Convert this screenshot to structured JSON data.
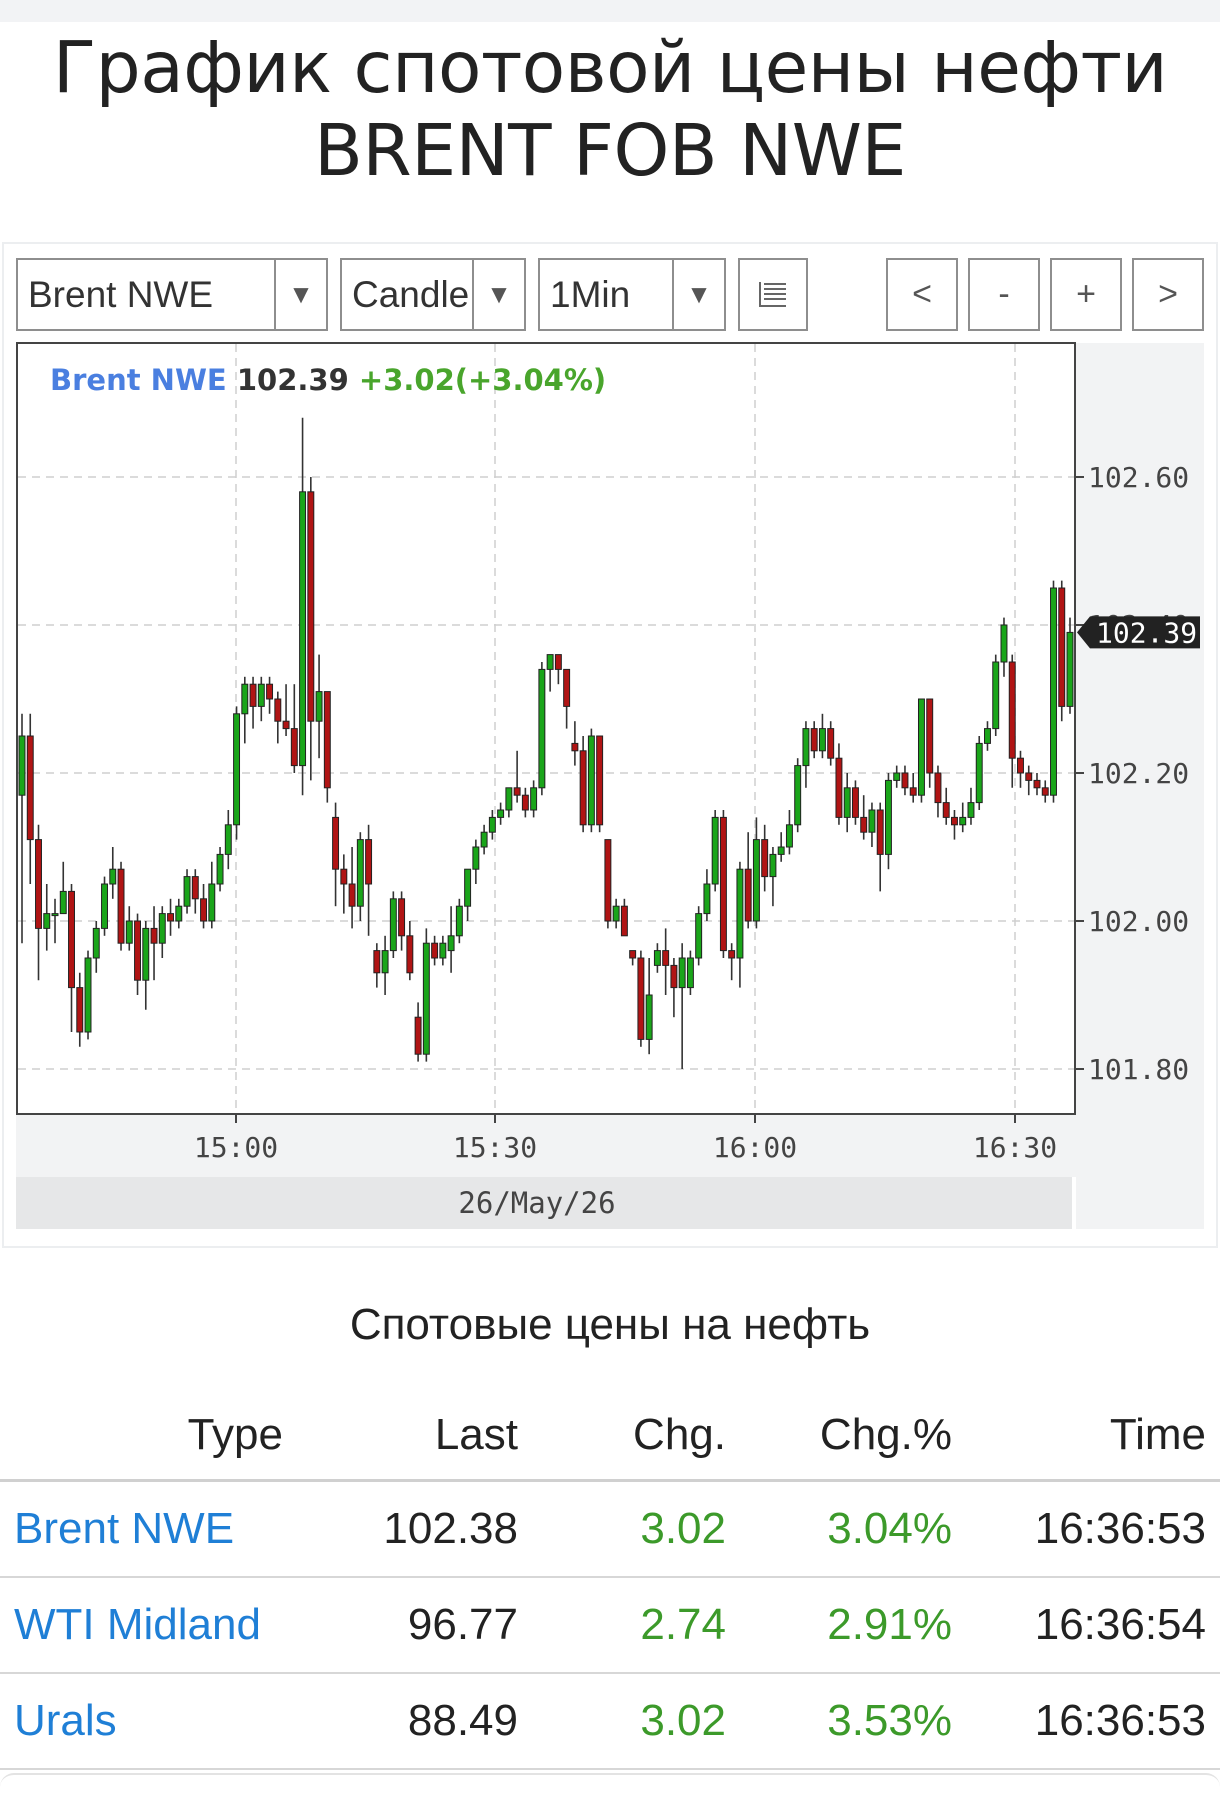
{
  "page": {
    "title": "График спотовой цены нефти BRENT FOB NWE"
  },
  "toolbar": {
    "symbol_select": "Brent NWE",
    "chart_type_select": "Candle",
    "interval_select": "1Min",
    "prev_label": "<",
    "zoom_out_label": "-",
    "zoom_in_label": "+",
    "next_label": ">"
  },
  "chart_info": {
    "symbol": "Brent NWE",
    "last": "102.39",
    "change": "+3.02(+3.04%)",
    "date_label": "26/May/26",
    "last_price_marker": "102.39"
  },
  "colors": {
    "up": "#1aa51a",
    "down": "#b01414",
    "symbol_blue": "#4a7fe0",
    "change_green": "#49a52c"
  },
  "chart_data": {
    "type": "candlestick",
    "ylim": [
      101.75,
      102.76
    ],
    "y_ticks": [
      101.8,
      102.0,
      102.2,
      102.4,
      102.6
    ],
    "y_tick_labels": [
      "101.80",
      "102.00",
      "102.20",
      "102.40",
      "102.60"
    ],
    "x_ticks": [
      "15:00",
      "15:30",
      "16:00",
      "16:30"
    ],
    "candles": [
      {
        "o": 102.17,
        "c": 102.25,
        "h": 102.28,
        "l": 101.97
      },
      {
        "o": 102.25,
        "c": 102.11,
        "h": 102.28,
        "l": 102.05
      },
      {
        "o": 102.11,
        "c": 101.99,
        "h": 102.13,
        "l": 101.92
      },
      {
        "o": 101.99,
        "c": 102.01,
        "h": 102.05,
        "l": 101.96
      },
      {
        "o": 102.01,
        "c": 102.01,
        "h": 102.03,
        "l": 101.97
      },
      {
        "o": 102.01,
        "c": 102.04,
        "h": 102.08,
        "l": 102.02
      },
      {
        "o": 102.04,
        "c": 101.91,
        "h": 102.05,
        "l": 101.85
      },
      {
        "o": 101.91,
        "c": 101.85,
        "h": 101.93,
        "l": 101.83
      },
      {
        "o": 101.85,
        "c": 101.95,
        "h": 101.96,
        "l": 101.84
      },
      {
        "o": 101.95,
        "c": 101.99,
        "h": 102.0,
        "l": 101.93
      },
      {
        "o": 101.99,
        "c": 102.05,
        "h": 102.06,
        "l": 101.98
      },
      {
        "o": 102.05,
        "c": 102.07,
        "h": 102.1,
        "l": 102.03
      },
      {
        "o": 102.07,
        "c": 101.97,
        "h": 102.08,
        "l": 101.96
      },
      {
        "o": 101.97,
        "c": 102.0,
        "h": 102.02,
        "l": 101.96
      },
      {
        "o": 102.0,
        "c": 101.92,
        "h": 102.01,
        "l": 101.9
      },
      {
        "o": 101.92,
        "c": 101.99,
        "h": 102.0,
        "l": 101.88
      },
      {
        "o": 101.99,
        "c": 101.97,
        "h": 102.02,
        "l": 101.92
      },
      {
        "o": 101.97,
        "c": 102.01,
        "h": 102.02,
        "l": 101.95
      },
      {
        "o": 102.01,
        "c": 102.0,
        "h": 102.03,
        "l": 101.98
      },
      {
        "o": 102.0,
        "c": 102.02,
        "h": 102.03,
        "l": 101.99
      },
      {
        "o": 102.02,
        "c": 102.06,
        "h": 102.07,
        "l": 102.01
      },
      {
        "o": 102.06,
        "c": 102.03,
        "h": 102.07,
        "l": 102.01
      },
      {
        "o": 102.03,
        "c": 102.0,
        "h": 102.05,
        "l": 101.99
      },
      {
        "o": 102.0,
        "c": 102.05,
        "h": 102.08,
        "l": 101.99
      },
      {
        "o": 102.05,
        "c": 102.09,
        "h": 102.1,
        "l": 102.04
      },
      {
        "o": 102.09,
        "c": 102.13,
        "h": 102.15,
        "l": 102.07
      },
      {
        "o": 102.13,
        "c": 102.28,
        "h": 102.29,
        "l": 102.11
      },
      {
        "o": 102.28,
        "c": 102.32,
        "h": 102.33,
        "l": 102.24
      },
      {
        "o": 102.32,
        "c": 102.29,
        "h": 102.33,
        "l": 102.26
      },
      {
        "o": 102.29,
        "c": 102.32,
        "h": 102.33,
        "l": 102.27
      },
      {
        "o": 102.32,
        "c": 102.3,
        "h": 102.33,
        "l": 102.28
      },
      {
        "o": 102.3,
        "c": 102.27,
        "h": 102.31,
        "l": 102.24
      },
      {
        "o": 102.27,
        "c": 102.26,
        "h": 102.32,
        "l": 102.25
      },
      {
        "o": 102.26,
        "c": 102.21,
        "h": 102.32,
        "l": 102.2
      },
      {
        "o": 102.21,
        "c": 102.58,
        "h": 102.68,
        "l": 102.17
      },
      {
        "o": 102.58,
        "c": 102.27,
        "h": 102.6,
        "l": 102.19
      },
      {
        "o": 102.27,
        "c": 102.31,
        "h": 102.36,
        "l": 102.22
      },
      {
        "o": 102.31,
        "c": 102.18,
        "h": 102.31,
        "l": 102.16
      },
      {
        "o": 102.14,
        "c": 102.07,
        "h": 102.16,
        "l": 102.02
      },
      {
        "o": 102.07,
        "c": 102.05,
        "h": 102.09,
        "l": 102.01
      },
      {
        "o": 102.05,
        "c": 102.02,
        "h": 102.1,
        "l": 101.99
      },
      {
        "o": 102.02,
        "c": 102.11,
        "h": 102.12,
        "l": 102.0
      },
      {
        "o": 102.11,
        "c": 102.05,
        "h": 102.13,
        "l": 101.98
      },
      {
        "o": 101.96,
        "c": 101.93,
        "h": 101.97,
        "l": 101.91
      },
      {
        "o": 101.93,
        "c": 101.96,
        "h": 101.98,
        "l": 101.9
      },
      {
        "o": 101.96,
        "c": 102.03,
        "h": 102.04,
        "l": 101.95
      },
      {
        "o": 102.03,
        "c": 101.98,
        "h": 102.04,
        "l": 101.96
      },
      {
        "o": 101.98,
        "c": 101.93,
        "h": 102.0,
        "l": 101.92
      },
      {
        "o": 101.87,
        "c": 101.82,
        "h": 101.89,
        "l": 101.81
      },
      {
        "o": 101.82,
        "c": 101.97,
        "h": 101.99,
        "l": 101.81
      },
      {
        "o": 101.97,
        "c": 101.95,
        "h": 101.98,
        "l": 101.94
      },
      {
        "o": 101.95,
        "c": 101.97,
        "h": 101.98,
        "l": 101.94
      },
      {
        "o": 101.96,
        "c": 101.98,
        "h": 102.02,
        "l": 101.93
      },
      {
        "o": 101.98,
        "c": 102.02,
        "h": 102.03,
        "l": 101.97
      },
      {
        "o": 102.02,
        "c": 102.07,
        "h": 102.07,
        "l": 102.0
      },
      {
        "o": 102.07,
        "c": 102.1,
        "h": 102.11,
        "l": 102.05
      },
      {
        "o": 102.1,
        "c": 102.12,
        "h": 102.13,
        "l": 102.09
      },
      {
        "o": 102.12,
        "c": 102.14,
        "h": 102.15,
        "l": 102.11
      },
      {
        "o": 102.14,
        "c": 102.15,
        "h": 102.16,
        "l": 102.13
      },
      {
        "o": 102.15,
        "c": 102.18,
        "h": 102.18,
        "l": 102.14
      },
      {
        "o": 102.18,
        "c": 102.17,
        "h": 102.23,
        "l": 102.16
      },
      {
        "o": 102.17,
        "c": 102.15,
        "h": 102.18,
        "l": 102.14
      },
      {
        "o": 102.15,
        "c": 102.18,
        "h": 102.19,
        "l": 102.14
      },
      {
        "o": 102.18,
        "c": 102.34,
        "h": 102.35,
        "l": 102.17
      },
      {
        "o": 102.34,
        "c": 102.36,
        "h": 102.36,
        "l": 102.31
      },
      {
        "o": 102.36,
        "c": 102.34,
        "h": 102.36,
        "l": 102.32
      },
      {
        "o": 102.34,
        "c": 102.29,
        "h": 102.34,
        "l": 102.26
      },
      {
        "o": 102.24,
        "c": 102.23,
        "h": 102.27,
        "l": 102.21
      },
      {
        "o": 102.23,
        "c": 102.13,
        "h": 102.25,
        "l": 102.12
      },
      {
        "o": 102.13,
        "c": 102.25,
        "h": 102.26,
        "l": 102.12
      },
      {
        "o": 102.25,
        "c": 102.13,
        "h": 102.25,
        "l": 102.12
      },
      {
        "o": 102.11,
        "c": 102.0,
        "h": 102.11,
        "l": 101.99
      },
      {
        "o": 102.0,
        "c": 102.02,
        "h": 102.03,
        "l": 101.99
      },
      {
        "o": 102.02,
        "c": 101.98,
        "h": 102.03,
        "l": 101.98
      },
      {
        "o": 101.96,
        "c": 101.95,
        "h": 101.96,
        "l": 101.94
      },
      {
        "o": 101.95,
        "c": 101.84,
        "h": 101.96,
        "l": 101.83
      },
      {
        "o": 101.84,
        "c": 101.9,
        "h": 101.95,
        "l": 101.82
      },
      {
        "o": 101.94,
        "c": 101.96,
        "h": 101.97,
        "l": 101.93
      },
      {
        "o": 101.96,
        "c": 101.94,
        "h": 101.99,
        "l": 101.9
      },
      {
        "o": 101.94,
        "c": 101.91,
        "h": 101.95,
        "l": 101.87
      },
      {
        "o": 101.91,
        "c": 101.95,
        "h": 101.97,
        "l": 101.8
      },
      {
        "o": 101.91,
        "c": 101.95,
        "h": 101.96,
        "l": 101.9
      },
      {
        "o": 101.95,
        "c": 102.01,
        "h": 102.02,
        "l": 101.94
      },
      {
        "o": 102.01,
        "c": 102.05,
        "h": 102.07,
        "l": 102.0
      },
      {
        "o": 102.05,
        "c": 102.14,
        "h": 102.15,
        "l": 102.04
      },
      {
        "o": 102.14,
        "c": 101.96,
        "h": 102.15,
        "l": 101.95
      },
      {
        "o": 101.96,
        "c": 101.95,
        "h": 101.97,
        "l": 101.92
      },
      {
        "o": 101.95,
        "c": 102.07,
        "h": 102.08,
        "l": 101.91
      },
      {
        "o": 102.07,
        "c": 102.0,
        "h": 102.12,
        "l": 101.99
      },
      {
        "o": 102.0,
        "c": 102.11,
        "h": 102.14,
        "l": 101.99
      },
      {
        "o": 102.11,
        "c": 102.06,
        "h": 102.13,
        "l": 102.04
      },
      {
        "o": 102.06,
        "c": 102.09,
        "h": 102.1,
        "l": 102.02
      },
      {
        "o": 102.09,
        "c": 102.1,
        "h": 102.12,
        "l": 102.08
      },
      {
        "o": 102.1,
        "c": 102.13,
        "h": 102.15,
        "l": 102.09
      },
      {
        "o": 102.13,
        "c": 102.21,
        "h": 102.22,
        "l": 102.12
      },
      {
        "o": 102.21,
        "c": 102.26,
        "h": 102.27,
        "l": 102.18
      },
      {
        "o": 102.26,
        "c": 102.23,
        "h": 102.27,
        "l": 102.22
      },
      {
        "o": 102.23,
        "c": 102.26,
        "h": 102.28,
        "l": 102.22
      },
      {
        "o": 102.26,
        "c": 102.22,
        "h": 102.27,
        "l": 102.21
      },
      {
        "o": 102.22,
        "c": 102.14,
        "h": 102.24,
        "l": 102.13
      },
      {
        "o": 102.14,
        "c": 102.18,
        "h": 102.2,
        "l": 102.12
      },
      {
        "o": 102.18,
        "c": 102.14,
        "h": 102.19,
        "l": 102.13
      },
      {
        "o": 102.14,
        "c": 102.12,
        "h": 102.17,
        "l": 102.11
      },
      {
        "o": 102.12,
        "c": 102.15,
        "h": 102.16,
        "l": 102.1
      },
      {
        "o": 102.15,
        "c": 102.09,
        "h": 102.16,
        "l": 102.04
      },
      {
        "o": 102.09,
        "c": 102.19,
        "h": 102.2,
        "l": 102.07
      },
      {
        "o": 102.19,
        "c": 102.2,
        "h": 102.21,
        "l": 102.18
      },
      {
        "o": 102.2,
        "c": 102.18,
        "h": 102.21,
        "l": 102.17
      },
      {
        "o": 102.18,
        "c": 102.17,
        "h": 102.2,
        "l": 102.16
      },
      {
        "o": 102.17,
        "c": 102.3,
        "h": 102.3,
        "l": 102.16
      },
      {
        "o": 102.3,
        "c": 102.2,
        "h": 102.3,
        "l": 102.18
      },
      {
        "o": 102.2,
        "c": 102.16,
        "h": 102.21,
        "l": 102.14
      },
      {
        "o": 102.16,
        "c": 102.14,
        "h": 102.18,
        "l": 102.13
      },
      {
        "o": 102.14,
        "c": 102.13,
        "h": 102.15,
        "l": 102.11
      },
      {
        "o": 102.13,
        "c": 102.14,
        "h": 102.16,
        "l": 102.12
      },
      {
        "o": 102.14,
        "c": 102.16,
        "h": 102.18,
        "l": 102.13
      },
      {
        "o": 102.16,
        "c": 102.24,
        "h": 102.25,
        "l": 102.15
      },
      {
        "o": 102.24,
        "c": 102.26,
        "h": 102.27,
        "l": 102.23
      },
      {
        "o": 102.26,
        "c": 102.35,
        "h": 102.36,
        "l": 102.25
      },
      {
        "o": 102.35,
        "c": 102.4,
        "h": 102.41,
        "l": 102.33
      },
      {
        "o": 102.35,
        "c": 102.22,
        "h": 102.36,
        "l": 102.18
      },
      {
        "o": 102.22,
        "c": 102.2,
        "h": 102.23,
        "l": 102.18
      },
      {
        "o": 102.2,
        "c": 102.19,
        "h": 102.21,
        "l": 102.17
      },
      {
        "o": 102.19,
        "c": 102.18,
        "h": 102.2,
        "l": 102.17
      },
      {
        "o": 102.18,
        "c": 102.17,
        "h": 102.19,
        "l": 102.16
      },
      {
        "o": 102.17,
        "c": 102.45,
        "h": 102.46,
        "l": 102.16
      },
      {
        "o": 102.45,
        "c": 102.29,
        "h": 102.46,
        "l": 102.27
      },
      {
        "o": 102.29,
        "c": 102.39,
        "h": 102.41,
        "l": 102.28
      }
    ]
  },
  "spot_section": {
    "title": "Спотовые цены на нефть",
    "columns": [
      "Type",
      "Last",
      "Chg.",
      "Chg.%",
      "Time"
    ],
    "rows": [
      {
        "type": "Brent NWE",
        "last": "102.38",
        "chg": "3.02",
        "pct": "3.04%",
        "time": "16:36:53"
      },
      {
        "type": "WTI Midland",
        "last": "96.77",
        "chg": "2.74",
        "pct": "2.91%",
        "time": "16:36:54"
      },
      {
        "type": "Urals",
        "last": "88.49",
        "chg": "3.02",
        "pct": "3.53%",
        "time": "16:36:53"
      }
    ]
  }
}
